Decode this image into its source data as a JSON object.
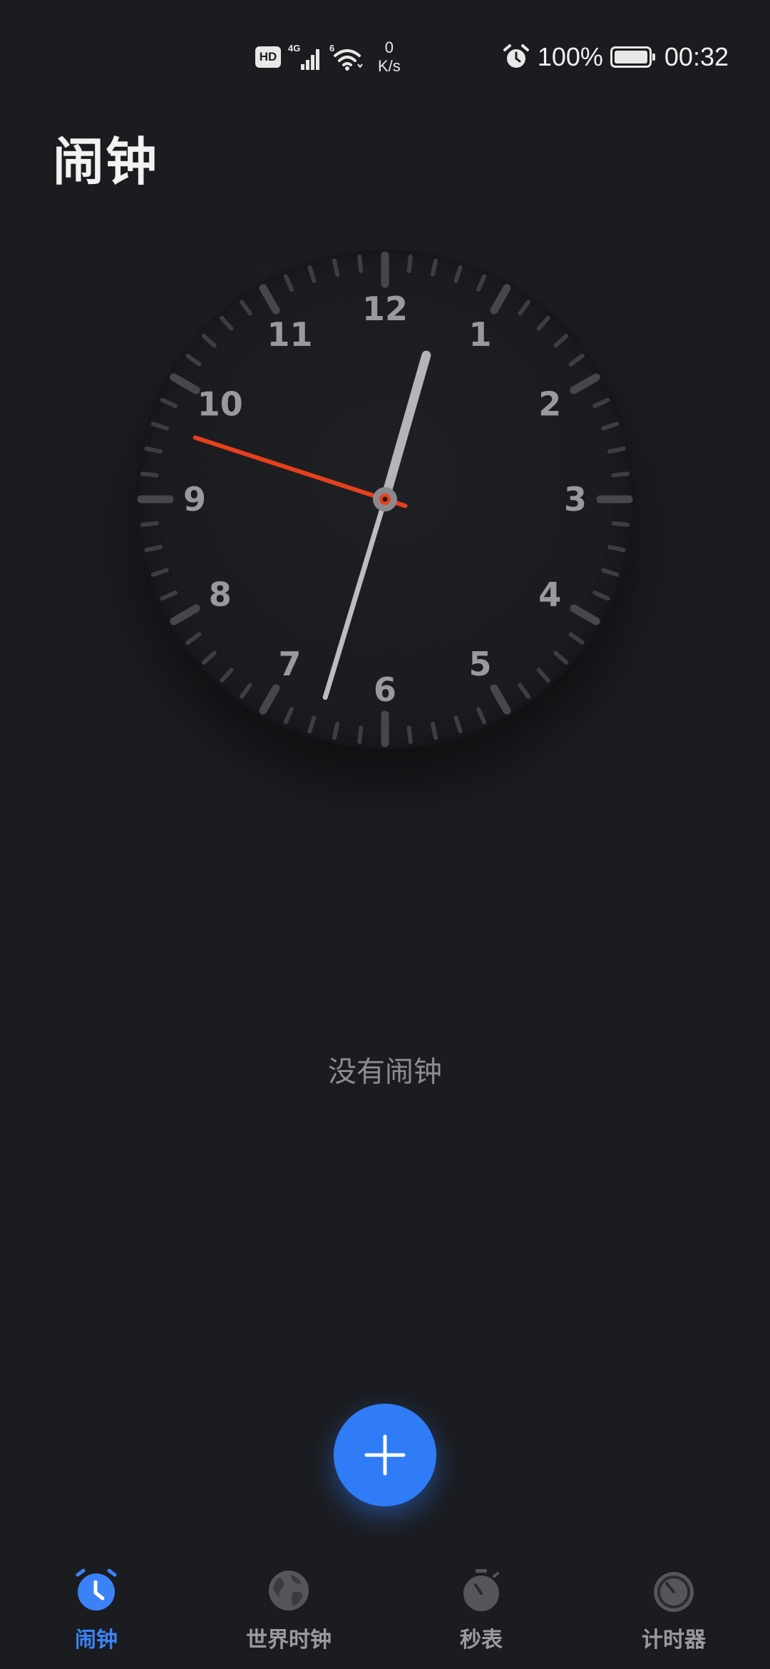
{
  "status_bar": {
    "hd_label": "HD",
    "network_label": "4G",
    "wifi_label": "6",
    "speed_value": "0",
    "speed_unit": "K/s",
    "battery_percent": "100%",
    "time": "00:32",
    "battery_level": 1.0
  },
  "header": {
    "title": "闹钟"
  },
  "clock": {
    "numbers": [
      "12",
      "1",
      "2",
      "3",
      "4",
      "5",
      "6",
      "7",
      "8",
      "9",
      "10",
      "11"
    ],
    "hour": 0,
    "minute": 32,
    "second": 48,
    "second_hand_color": "#e8401c"
  },
  "main": {
    "empty_text": "没有闹钟"
  },
  "fab": {
    "icon": "plus-icon",
    "color": "#2f7cf6"
  },
  "bottom_nav": {
    "items": [
      {
        "label": "闹钟",
        "icon": "alarm-clock-icon",
        "active": true
      },
      {
        "label": "世界时钟",
        "icon": "globe-icon",
        "active": false
      },
      {
        "label": "秒表",
        "icon": "stopwatch-icon",
        "active": false
      },
      {
        "label": "计时器",
        "icon": "timer-icon",
        "active": false
      }
    ],
    "active_color": "#3b82f6"
  }
}
